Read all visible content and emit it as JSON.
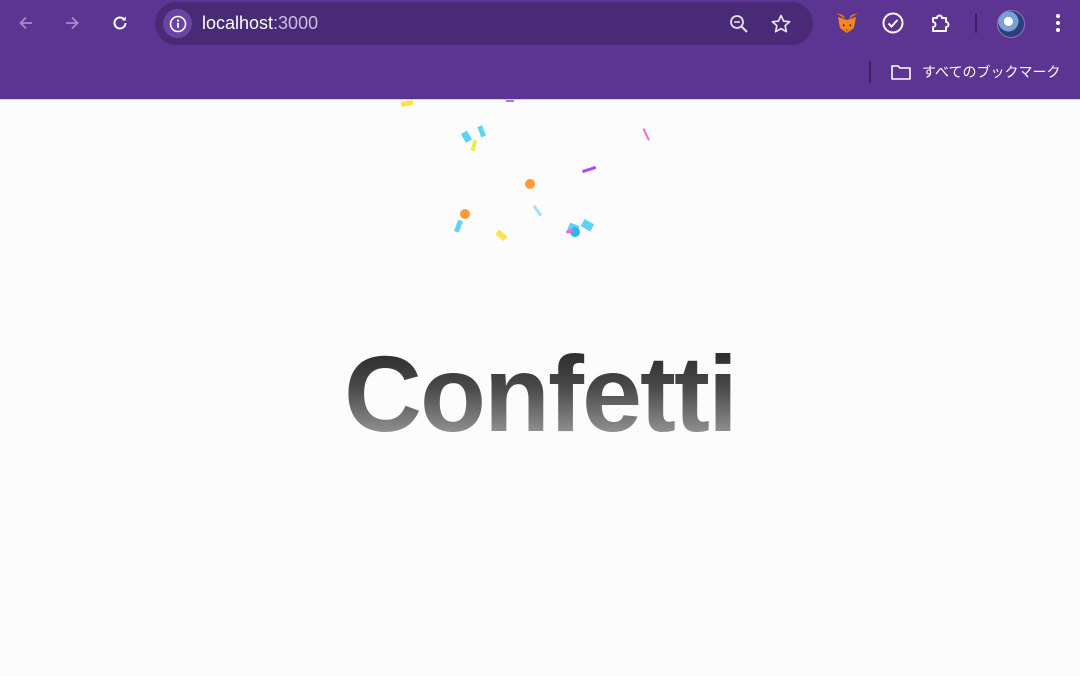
{
  "browser": {
    "address_host": "localhost",
    "address_port": ":3000",
    "bookmarks_label": "すべてのブックマーク",
    "icons": [
      "back-arrow-icon",
      "forward-arrow-icon",
      "reload-icon",
      "site-info-icon",
      "zoom-icon",
      "bookmark-star-icon",
      "metamask-fox-icon",
      "check-circle-icon",
      "extensions-puzzle-icon",
      "profile-avatar",
      "kebab-menu-icon",
      "folder-icon"
    ],
    "colors": {
      "frame": "#5c3593",
      "omnibox": "#492a76"
    }
  },
  "page": {
    "headline": "Confetti"
  },
  "confetti": {
    "colors": [
      "#ffe14d",
      "#5fd3f5",
      "#ff9a3c",
      "#b36bf0",
      "#ff66c4",
      "#a64dff",
      "#e8f04a"
    ]
  }
}
